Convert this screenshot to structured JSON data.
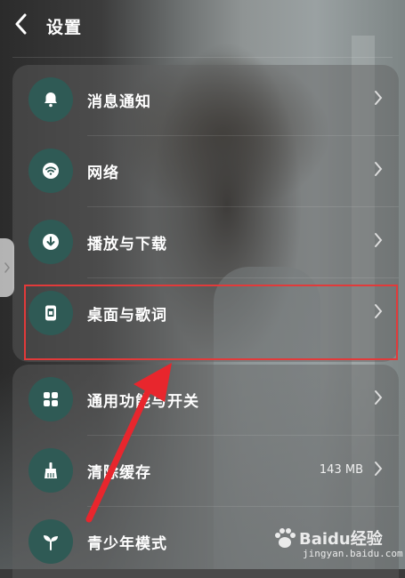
{
  "header": {
    "title": "设置"
  },
  "settings": [
    {
      "label": "消息通知",
      "icon": "bell-icon"
    },
    {
      "label": "网络",
      "icon": "wifi-icon"
    },
    {
      "label": "播放与下载",
      "icon": "download-icon"
    },
    {
      "label": "桌面与歌词",
      "icon": "phone-widget-icon"
    },
    {
      "label": "通用功能与开关",
      "icon": "grid-icon"
    },
    {
      "label": "清除缓存",
      "icon": "broom-icon",
      "value": "143 MB"
    },
    {
      "label": "青少年模式",
      "icon": "sprout-icon"
    }
  ],
  "watermark": {
    "text": "Baidu经验",
    "url_text": "jingyan.baidu.com"
  },
  "colors": {
    "icon_bg": "#2f5a55",
    "highlight": "#e23a3a",
    "arrow": "#e8262d"
  }
}
